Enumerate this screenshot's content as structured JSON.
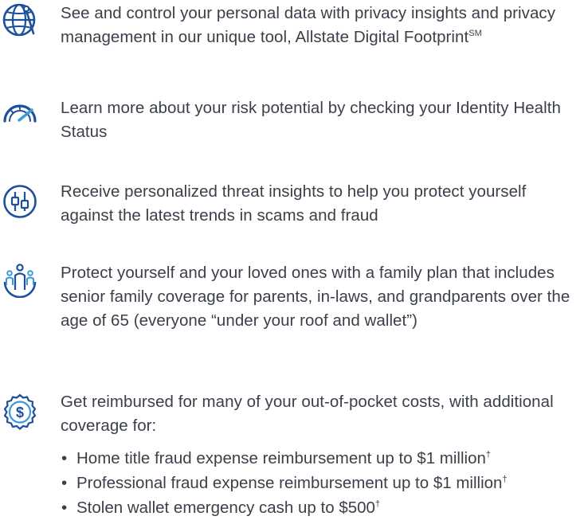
{
  "colors": {
    "icon_blue": "#1e4f9c",
    "text": "#3a3f4a"
  },
  "features": [
    {
      "icon": "globe-icon",
      "text": "See and control your personal data with privacy insights and privacy management in our unique tool, Allstate Digital Footprint",
      "superscript": "SM"
    },
    {
      "icon": "speedometer-icon",
      "text": "Learn more about your risk potential by checking your Identity Health Status"
    },
    {
      "icon": "insights-sliders-icon",
      "text": "Receive personalized threat insights to help you protect yourself against the latest trends in scams and fraud"
    },
    {
      "icon": "family-icon",
      "text": "Protect yourself and your loved ones with a family plan that includes senior family coverage for parents, in-laws, and grandparents over the age of 65 (everyone “under your roof and wallet”)"
    },
    {
      "icon": "dollar-badge-icon",
      "text": "Get reimbursed for many of your out-of-pocket costs, with additional coverage for:"
    }
  ],
  "coverage_bullets": [
    {
      "text": "Home title fraud expense reimbursement up to $1 million",
      "mark": "†"
    },
    {
      "text": "Professional fraud expense reimbursement up to $1 million",
      "mark": "†"
    },
    {
      "text": "Stolen wallet emergency cash up to $500",
      "mark": "†"
    }
  ],
  "bullet_glyph": "•"
}
